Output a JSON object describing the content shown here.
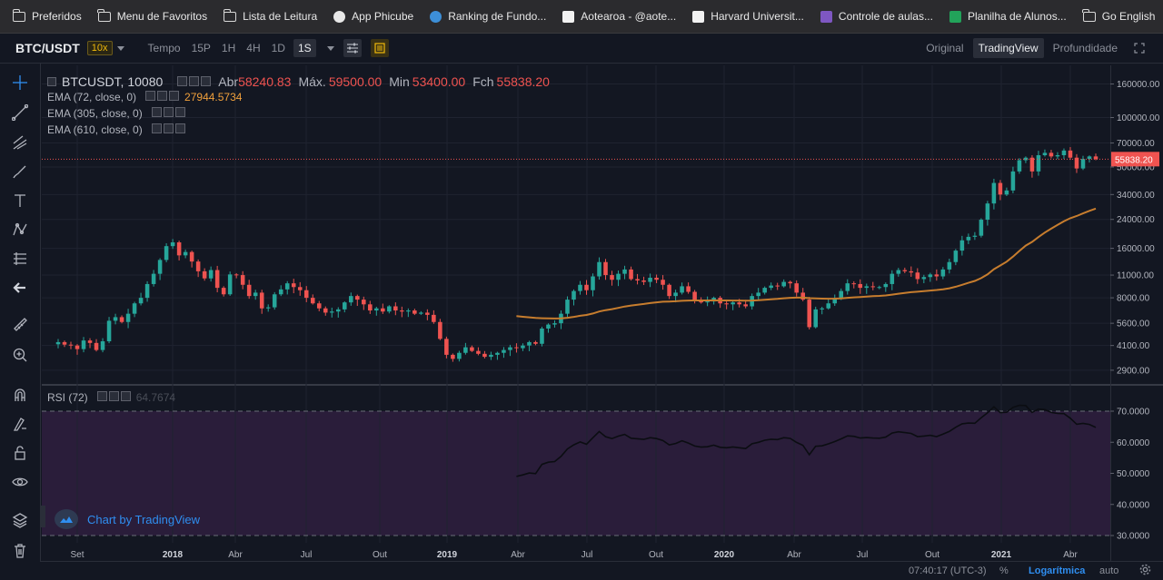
{
  "bookmarks": [
    {
      "label": "Preferidos",
      "icon": "folder-icon"
    },
    {
      "label": "Menu de Favoritos",
      "icon": "folder-icon"
    },
    {
      "label": "Lista de Leitura",
      "icon": "folder-icon"
    },
    {
      "label": "App Phicube",
      "icon": "github-icon"
    },
    {
      "label": "Ranking de Fundo...",
      "icon": "feather-icon"
    },
    {
      "label": "Aotearoa - @aote...",
      "icon": "triangle-logo-icon"
    },
    {
      "label": "Harvard Universit...",
      "icon": "harvard-icon"
    },
    {
      "label": "Controle de aulas...",
      "icon": "form-icon"
    },
    {
      "label": "Planilha de Alunos...",
      "icon": "sheet-icon"
    },
    {
      "label": "Go English",
      "icon": "folder-icon"
    }
  ],
  "colors": {
    "background": "#131722",
    "up": "#26a69a",
    "down": "#ef5350",
    "ema": "#c77d2e",
    "rsi_fill": "#2a1d3a",
    "price_tag": "#ef5350",
    "leverage": "#f0b90b"
  },
  "toolbar": {
    "symbol": "BTC/USDT",
    "leverage": "10x",
    "tempo": "Tempo",
    "timeframes": [
      "15P",
      "1H",
      "4H",
      "1D",
      "1S"
    ],
    "active_timeframe": "1S",
    "views": [
      "Original",
      "TradingView",
      "Profundidade"
    ],
    "active_view": "TradingView"
  },
  "legend": {
    "title": "BTCUSDT, 10080",
    "open_label": "Abr",
    "open": "58240.83",
    "high_label": "Máx.",
    "high": "59500.00",
    "low_label": "Min",
    "low": "53400.00",
    "close_label": "Fch",
    "close": "55838.20",
    "ema1": "EMA (72, close, 0)",
    "ema1_value": "27944.5734",
    "ema2": "EMA (305, close, 0)",
    "ema3": "EMA (610, close, 0)",
    "rsi": "RSI (72)",
    "rsi_value": "64.7674"
  },
  "watermark": "Chart by TradingView",
  "statusbar": {
    "time": "07:40:17 (UTC-3)",
    "percent": "%",
    "log": "Logarítmica",
    "auto": "auto"
  },
  "left_tools": [
    "crosshair-icon",
    "trend-line-icon",
    "pitchfork-icon",
    "brush-icon",
    "text-icon",
    "pattern-icon",
    "prediction-icon",
    "back-arrow-icon",
    "ruler-icon",
    "zoom-in-icon",
    "magnet-icon",
    "lock-drawing-icon",
    "lock-icon",
    "eye-icon",
    "layers-icon",
    "trash-icon"
  ],
  "chart_data": {
    "type": "candlestick",
    "price_scale": "log",
    "price_axis_labels": [
      "160000.00",
      "100000.00",
      "70000.00",
      "50000.00",
      "34000.00",
      "24000.00",
      "16000.00",
      "11000.00",
      "8000.00",
      "5600.00",
      "4100.00",
      "2900.00"
    ],
    "price_axis_values": [
      160000,
      100000,
      70000,
      50000,
      34000,
      24000,
      16000,
      11000,
      8000,
      5600,
      4100,
      2900
    ],
    "price_range": [
      2550,
      195000
    ],
    "last_price": "55838.20",
    "last_price_value": 55838,
    "time_axis_labels": [
      "Set",
      "2018",
      "Abr",
      "Jul",
      "Out",
      "2019",
      "Abr",
      "Jul",
      "Out",
      "2020",
      "Abr",
      "Jul",
      "Out",
      "2021",
      "Abr"
    ],
    "candle_closes": [
      4300,
      4150,
      4100,
      3900,
      4400,
      4250,
      3850,
      4350,
      5800,
      6100,
      5700,
      6400,
      7400,
      8000,
      9700,
      11200,
      13600,
      16500,
      17400,
      14500,
      15200,
      13300,
      11600,
      10500,
      11800,
      9200,
      8400,
      11100,
      11000,
      9600,
      8200,
      8600,
      6900,
      7000,
      8400,
      9000,
      9800,
      9300,
      8900,
      8000,
      7400,
      6900,
      6500,
      6600,
      6800,
      7500,
      8200,
      7800,
      7300,
      6700,
      6900,
      6600,
      7100,
      6700,
      6600,
      6700,
      6400,
      6500,
      6300,
      5700,
      4500,
      3600,
      3400,
      3700,
      4000,
      3800,
      3650,
      3500,
      3600,
      3700,
      3850,
      4000,
      3950,
      4100,
      4300,
      4200,
      5200,
      5500,
      5600,
      6400,
      7800,
      8800,
      9600,
      8900,
      10800,
      13200,
      11000,
      10300,
      11200,
      11900,
      10400,
      10200,
      10000,
      10600,
      10300,
      9600,
      8200,
      8600,
      9400,
      8700,
      7800,
      7500,
      7600,
      8000,
      7400,
      7300,
      7500,
      7300,
      7100,
      8200,
      8600,
      9200,
      9500,
      9400,
      10000,
      9800,
      8600,
      7800,
      5300,
      6800,
      6900,
      7400,
      8000,
      8800,
      9800,
      9700,
      9200,
      9400,
      9300,
      9300,
      9700,
      11200,
      11800,
      11600,
      11400,
      10400,
      10700,
      11100,
      10800,
      11900,
      13200,
      15500,
      17900,
      18800,
      19100,
      23900,
      30000,
      40000,
      34000,
      36000,
      47000,
      55000,
      57000,
      47000,
      59000,
      61000,
      58000,
      59000,
      63000,
      57000,
      49000,
      56000,
      58000,
      55838
    ],
    "ema_start_candle": 72,
    "ema_end_value": 27944.5734,
    "rsi_axis_labels": [
      "70.0000",
      "60.0000",
      "50.0000",
      "40.0000",
      "30.0000"
    ],
    "rsi_axis_values": [
      70,
      60,
      50,
      40,
      30
    ],
    "rsi_levels": [
      70,
      30
    ],
    "rsi_last": 64.7674
  }
}
